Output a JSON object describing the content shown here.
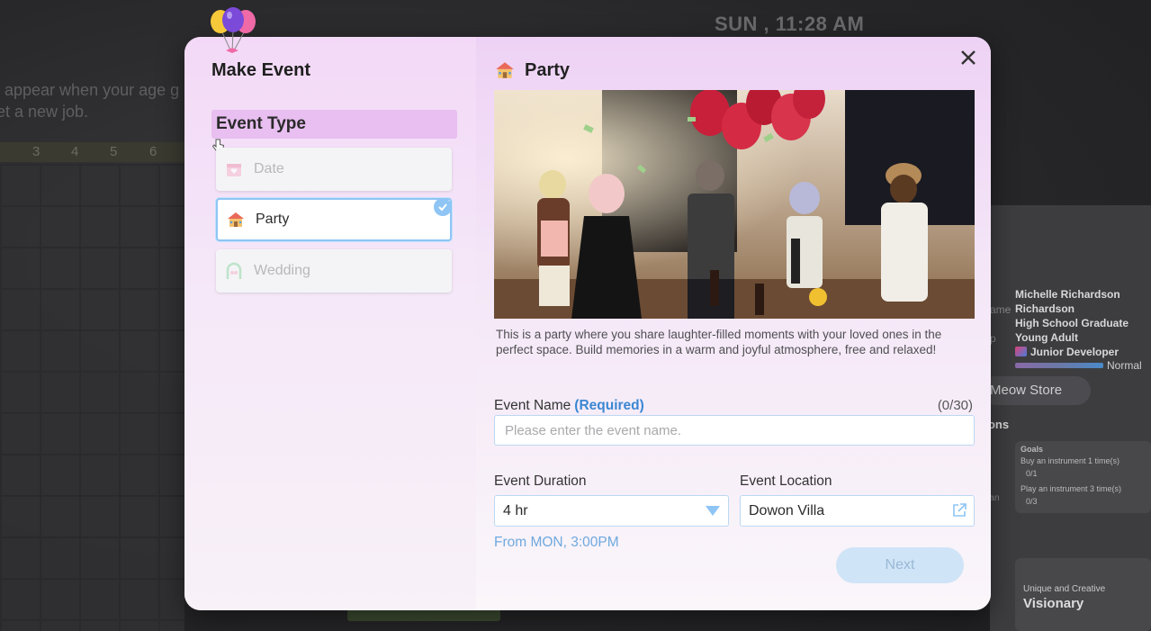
{
  "background": {
    "clock": "SUN , 11:28 AM",
    "hint_lines": [
      "l appear when your age g",
      "et a new job."
    ],
    "ruler_numbers": [
      "3",
      "4",
      "5",
      "6"
    ],
    "profile": {
      "full_name": "Michelle Richardson",
      "last_name": "Richardson",
      "education": "High School Graduate",
      "life_stage": "Young Adult",
      "job": "Junior Developer",
      "status": "Normal",
      "partial_labels": [
        "ame",
        "p"
      ]
    },
    "store_button": "Meow Store",
    "missions_label": "tions",
    "goals": {
      "title": "Goals",
      "items": [
        {
          "text": "Buy an instrument 1 time(s)",
          "progress": "0/1"
        },
        {
          "text": "Play an instrument 3 time(s)",
          "progress": "0/3"
        }
      ],
      "partial_label": "ician"
    },
    "trait_card": {
      "subtitle": "Unique and Creative",
      "title": "Visionary"
    }
  },
  "modal": {
    "title": "Make Event",
    "event_type_heading": "Event Type",
    "event_types": [
      {
        "label": "Date",
        "icon": "calendar-heart-icon",
        "state": "disabled"
      },
      {
        "label": "Party",
        "icon": "party-house-icon",
        "state": "selected"
      },
      {
        "label": "Wedding",
        "icon": "wedding-arch-icon",
        "state": "disabled"
      }
    ],
    "detail": {
      "title": "Party",
      "image_alt": "party-photo",
      "description": "This is a party where you share laughter-filled moments with your loved ones in the perfect space. Build memories in a warm and joyful atmosphere, free and relaxed!",
      "event_name_label": "Event Name",
      "required_label": "(Required)",
      "name_counter": "(0/30)",
      "name_value": "",
      "name_placeholder": "Please enter the event name.",
      "duration_label": "Event Duration",
      "duration_value": "4 hr",
      "location_label": "Event Location",
      "location_value": "Dowon Villa",
      "start_time": "From MON, 3:00PM",
      "next_button": "Next"
    }
  },
  "colors": {
    "accent_blue": "#8ec5f5",
    "required_blue": "#3a87d3",
    "section_pink": "#e8bff0",
    "next_disabled": "#cfe4f7"
  }
}
